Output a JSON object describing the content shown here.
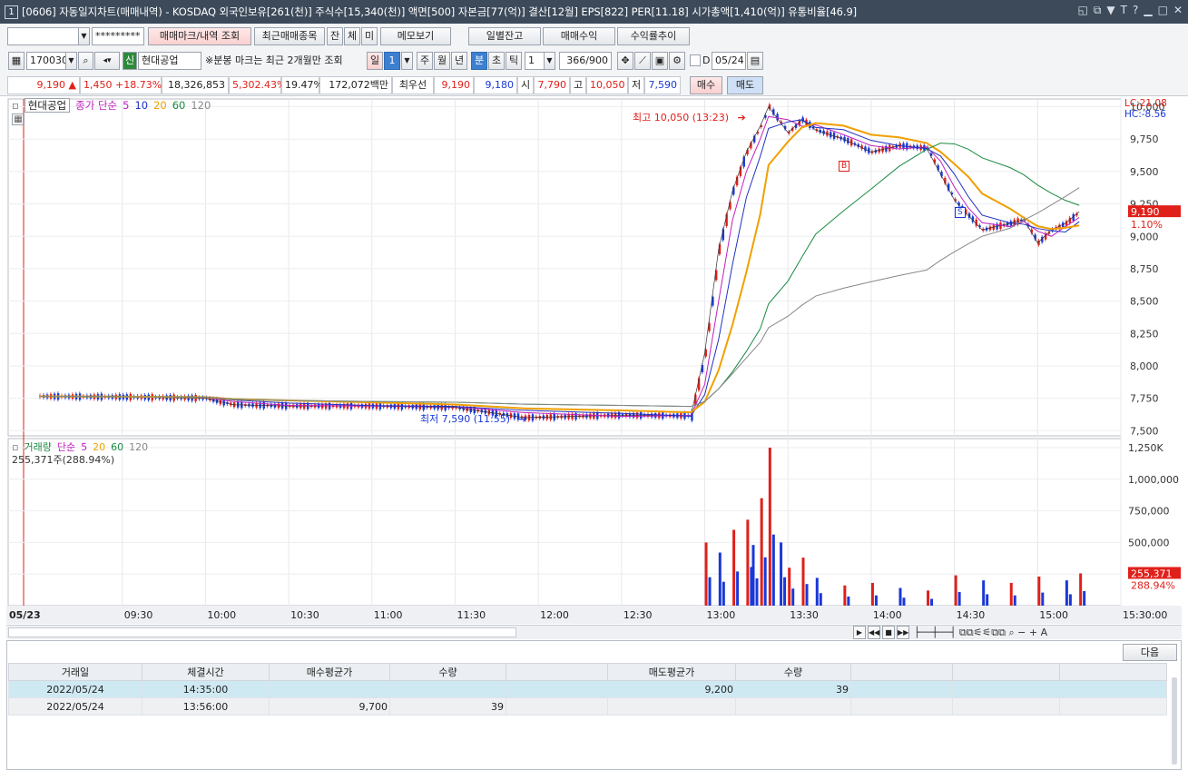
{
  "window": {
    "badge": "1",
    "title": "[0606] 자동일지차트(매매내역) - KOSDAQ 외국인보유[261(천)] 주식수[15,340(천)] 액면[500] 자본금[77(억)] 결산[12월] EPS[822] PER[11.18] 시가총액[1,410(억)] 유통비율[46.9]",
    "icons": [
      "◱",
      "⧉",
      "▼",
      "T",
      "?",
      "▁",
      "□",
      "✕"
    ]
  },
  "toolbar1": {
    "account_value": "",
    "password_mask": "*********",
    "mark_button": "매매마크/내역 조회",
    "recent_button": "최근매매종목",
    "jan_button": "잔",
    "che_button": "체",
    "mi_button": "미",
    "memo_button": "메모보기",
    "daily_balance_button": "일별잔고",
    "profit_button": "매매수익",
    "yield_button": "수익률추이"
  },
  "toolbar2": {
    "code": "170030",
    "new_badge": "신",
    "stock_name": "현대공업",
    "note": "※분봉 마크는 최근 2개월만 조회",
    "period_label": "일",
    "period_value": "1",
    "tabs": [
      "주",
      "월",
      "년",
      "분",
      "초",
      "틱"
    ],
    "interval": "1",
    "count": "366/900",
    "date_check_label": "D",
    "date": "05/24"
  },
  "quote": {
    "price": "9,190",
    "change": "1,450",
    "change_pct": "+18.73%",
    "volume": "18,326,853",
    "vol_ratio": "5,302.43%",
    "turnover": "19.47%",
    "amount": "172,072백만",
    "best_ask_label": "최우선",
    "best_ask": "9,190",
    "best_bid": "9,180",
    "open_label": "시",
    "open": "7,790",
    "high_label": "고",
    "high": "10,050",
    "low_label": "저",
    "low": "7,590",
    "buy_button": "매수",
    "sell_button": "매도"
  },
  "price_legend": {
    "name": "현대공업",
    "ma_label": "종가 단순",
    "mas": [
      "5",
      "10",
      "20",
      "60",
      "120"
    ]
  },
  "volume_legend": {
    "label": "거래량",
    "ma_label": "단순",
    "mas": [
      "5",
      "20",
      "60",
      "120"
    ],
    "current": "255,371주(288.94%)"
  },
  "annotations": {
    "high": "최고 10,050 (13:23)",
    "low": "최저 7,590 (11:55)",
    "lc": "LC:21.08",
    "hc": "HC:-8.56",
    "buy_mark": "B",
    "sell_mark": "S"
  },
  "chart_data": {
    "type": "candlestick",
    "x_label_date": "05/23",
    "x_ticks": [
      "09:30",
      "10:00",
      "10:30",
      "11:00",
      "11:30",
      "12:00",
      "12:30",
      "13:00",
      "13:30",
      "14:00",
      "14:30",
      "15:00",
      "15:30:00"
    ],
    "price_ticks": [
      "10,000",
      "9,750",
      "9,500",
      "9,250",
      "9,000",
      "8,750",
      "8,500",
      "8,250",
      "8,000",
      "7,750",
      "7,500"
    ],
    "price_ylim": [
      7460,
      10060
    ],
    "price_tag": "9,190",
    "price_tag_pct": "1.10%",
    "volume_ticks": [
      "1,250K",
      "1,000,000",
      "750,000",
      "500,000",
      "250,000"
    ],
    "volume_ylim": [
      0,
      1250000
    ],
    "volume_tag": "255,371",
    "volume_tag_pct": "288.94%",
    "price_path": [
      [
        "09:00",
        7765
      ],
      [
        "09:30",
        7760
      ],
      [
        "10:00",
        7750
      ],
      [
        "10:10",
        7700
      ],
      [
        "10:30",
        7690
      ],
      [
        "11:00",
        7690
      ],
      [
        "11:30",
        7680
      ],
      [
        "11:55",
        7600
      ],
      [
        "12:30",
        7620
      ],
      [
        "12:55",
        7615
      ],
      [
        "13:00",
        8100
      ],
      [
        "13:05",
        8900
      ],
      [
        "13:10",
        9350
      ],
      [
        "13:15",
        9650
      ],
      [
        "13:20",
        9850
      ],
      [
        "13:23",
        10000
      ],
      [
        "13:30",
        9800
      ],
      [
        "13:35",
        9900
      ],
      [
        "13:40",
        9820
      ],
      [
        "13:50",
        9750
      ],
      [
        "14:00",
        9650
      ],
      [
        "14:10",
        9700
      ],
      [
        "14:20",
        9680
      ],
      [
        "14:25",
        9480
      ],
      [
        "14:30",
        9280
      ],
      [
        "14:35",
        9160
      ],
      [
        "14:40",
        9050
      ],
      [
        "14:50",
        9100
      ],
      [
        "14:55",
        9130
      ],
      [
        "15:00",
        8950
      ],
      [
        "15:05",
        9050
      ],
      [
        "15:10",
        9100
      ],
      [
        "15:15",
        9190
      ]
    ],
    "volume_bars": [
      [
        "13:00",
        500000
      ],
      [
        "13:05",
        420000
      ],
      [
        "13:10",
        600000
      ],
      [
        "13:15",
        680000
      ],
      [
        "13:17",
        480000
      ],
      [
        "13:20",
        850000
      ],
      [
        "13:23",
        1250000
      ],
      [
        "13:27",
        500000
      ],
      [
        "13:30",
        300000
      ],
      [
        "13:35",
        380000
      ],
      [
        "13:40",
        220000
      ],
      [
        "13:50",
        160000
      ],
      [
        "14:00",
        180000
      ],
      [
        "14:10",
        140000
      ],
      [
        "14:20",
        120000
      ],
      [
        "14:30",
        240000
      ],
      [
        "14:40",
        200000
      ],
      [
        "14:50",
        180000
      ],
      [
        "15:00",
        230000
      ],
      [
        "15:10",
        200000
      ],
      [
        "15:15",
        255371
      ]
    ]
  },
  "trades_table": {
    "next_button": "다음",
    "headers": [
      "거래일",
      "체결시간",
      "매수평균가",
      "수량",
      "",
      "매도평균가",
      "수량",
      "",
      "",
      ""
    ],
    "rows": [
      [
        "2022/05/24",
        "14:35:00",
        "",
        "",
        "",
        "9,200",
        "39",
        "",
        "",
        ""
      ],
      [
        "2022/05/24",
        "13:56:00",
        "9,700",
        "39",
        "",
        "",
        "",
        "",
        "",
        ""
      ]
    ]
  },
  "colors": {
    "up": "#e0201a",
    "down": "#1a38d8",
    "ma5": "#c020c0",
    "ma10": "#2030c0",
    "ma20": "#f0a000",
    "ma60": "#1a8a40",
    "ma120": "#888888",
    "title_bg": "#3c4a5a"
  }
}
